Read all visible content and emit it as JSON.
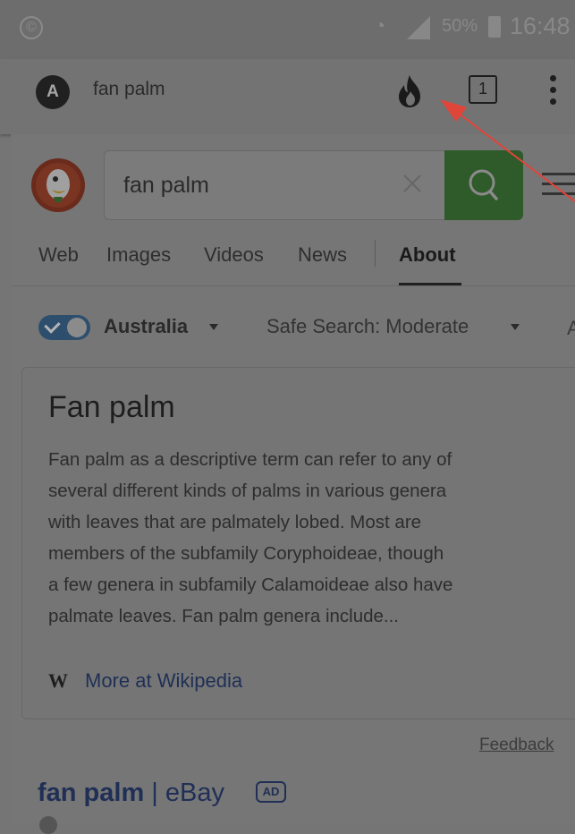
{
  "status_bar": {
    "battery": "50%",
    "time": "16:48"
  },
  "app_bar": {
    "avatar_letter": "A",
    "query": "fan palm",
    "tab_count": "1"
  },
  "search": {
    "value": "fan palm"
  },
  "nav": {
    "tabs": [
      "Web",
      "Images",
      "Videos",
      "News",
      "About"
    ],
    "active": "About"
  },
  "filters": {
    "region": "Australia",
    "safe_search": "Safe Search: Moderate",
    "partial": "A"
  },
  "info_card": {
    "title": "Fan palm",
    "lines": [
      "Fan palm as a descriptive term can refer to any of",
      "several different kinds of palms in various genera",
      "with leaves that are palmately lobed. Most are",
      "members of the subfamily Coryphoideae, though",
      "a few genera in subfamily Calamoideae also have",
      "palmate leaves. Fan palm genera include..."
    ],
    "wiki_icon": "W",
    "wiki_link": "More at Wikipedia"
  },
  "feedback": "Feedback",
  "result": {
    "title_bold": "fan palm",
    "title_rest": " | eBay",
    "ad_badge": "AD"
  },
  "colors": {
    "search_button": "#2f5a2a",
    "link": "#1f2f55",
    "annotation_arrow": "#e0453a",
    "toggle": "#2d4f6d"
  },
  "icons": [
    "duckduckgo-logo",
    "fire-icon",
    "tabs-icon",
    "overflow-menu-icon",
    "clear-icon",
    "search-icon",
    "hamburger-menu-icon",
    "wikipedia-icon"
  ]
}
